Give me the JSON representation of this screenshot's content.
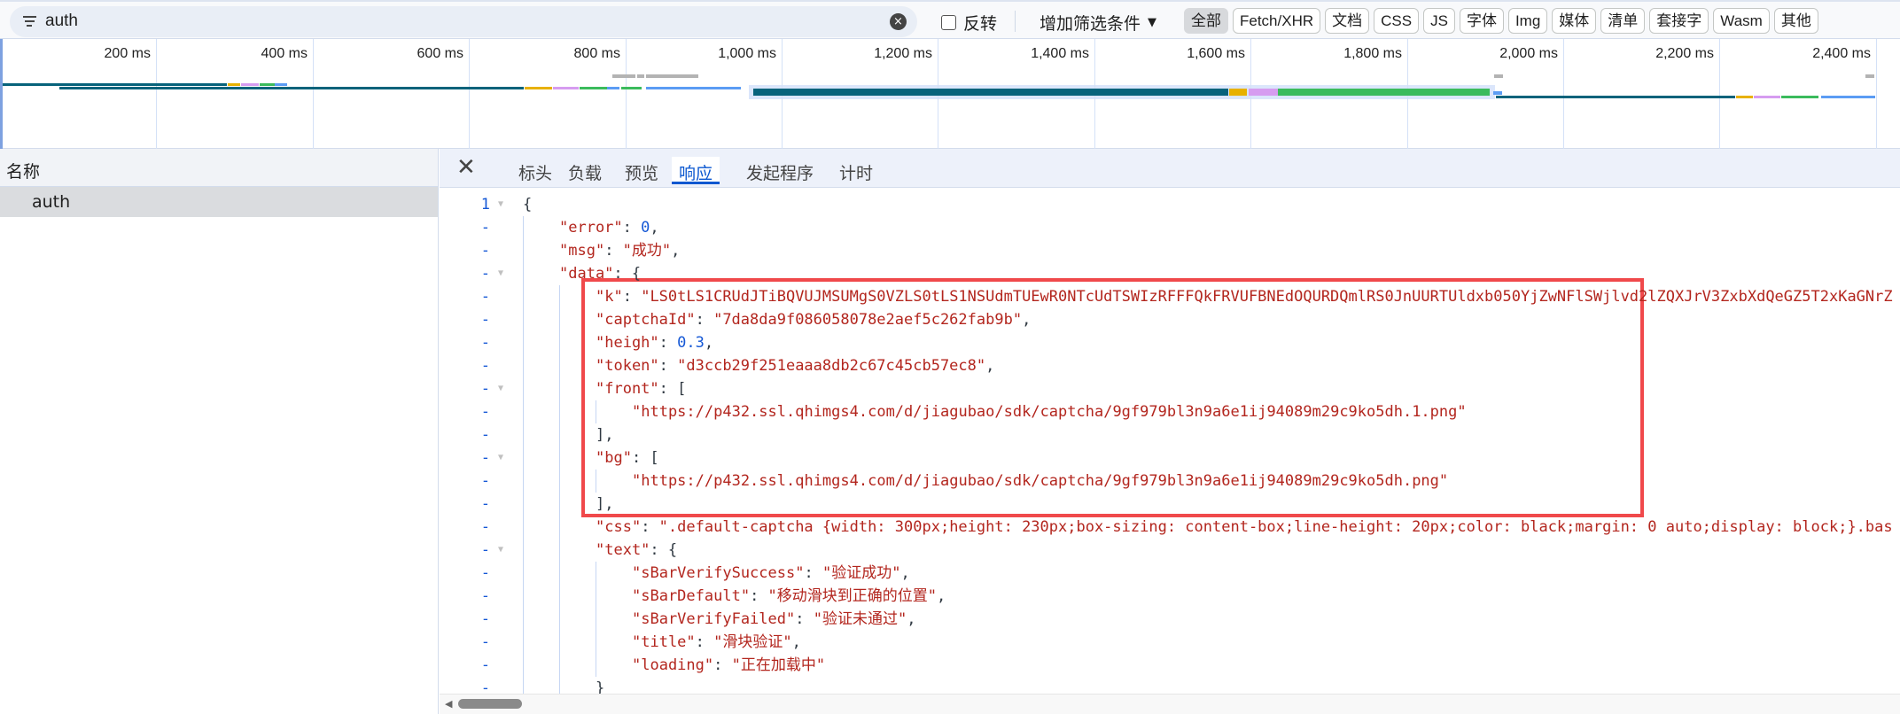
{
  "filter": {
    "value": "auth",
    "invert_label": "反转",
    "add_filter_label": "增加筛选条件",
    "types": [
      "全部",
      "Fetch/XHR",
      "文档",
      "CSS",
      "JS",
      "字体",
      "Img",
      "媒体",
      "清单",
      "套接字",
      "Wasm",
      "其他"
    ],
    "active_type": "全部"
  },
  "timeline": {
    "ticks": [
      "200 ms",
      "400 ms",
      "600 ms",
      "800 ms",
      "1,000 ms",
      "1,200 ms",
      "1,400 ms",
      "1,600 ms",
      "1,800 ms",
      "2,000 ms",
      "2,200 ms",
      "2,400 ms"
    ],
    "colors": {
      "waiting": "#07637b",
      "queue": "#e8b100",
      "purple": "#d69cf0",
      "green": "#3bbb5c",
      "blue": "#5b9cf4",
      "gray": "#b3b3b3"
    },
    "rows": [
      {
        "row": "gray",
        "segments": [
          [
            783,
            814,
            "gray"
          ],
          [
            815,
            825,
            "gray"
          ],
          [
            826,
            894,
            "gray"
          ],
          [
            1911,
            1923,
            "gray"
          ],
          [
            2387,
            2400,
            "gray"
          ]
        ]
      },
      {
        "row": "r1",
        "segments": [
          [
            3,
            291,
            "waiting"
          ],
          [
            291,
            308,
            "queue"
          ],
          [
            308,
            332,
            "purple"
          ],
          [
            332,
            352,
            "green"
          ],
          [
            352,
            369,
            "blue"
          ]
        ]
      },
      {
        "row": "r2",
        "segments": [
          [
            76,
            671,
            "waiting"
          ],
          [
            671,
            707,
            "queue"
          ],
          [
            707,
            741,
            "purple"
          ],
          [
            741,
            777,
            "green"
          ],
          [
            777,
            794,
            "blue"
          ],
          [
            795,
            822,
            "green"
          ],
          [
            826,
            949,
            "blue"
          ]
        ]
      },
      {
        "row": "selected",
        "segments": [
          [
            964,
            1573,
            "waiting"
          ],
          [
            1573,
            1597,
            "queue"
          ],
          [
            1597,
            1635,
            "purple"
          ],
          [
            1635,
            1907,
            "green"
          ],
          [
            1910,
            1922,
            "blue"
          ]
        ]
      },
      {
        "row": "r4",
        "segments": [
          [
            1914,
            2221,
            "waiting"
          ],
          [
            2221,
            2244,
            "queue"
          ],
          [
            2244,
            2279,
            "purple"
          ],
          [
            2279,
            2328,
            "green"
          ],
          [
            2330,
            2400,
            "blue"
          ]
        ]
      }
    ]
  },
  "requests": {
    "header": "名称",
    "items": [
      "auth"
    ]
  },
  "detail": {
    "tabs": [
      "标头",
      "负载",
      "预览",
      "响应",
      "发起程序",
      "计时"
    ],
    "active_tab": "响应",
    "lines": [
      {
        "num": "1",
        "ind": 0,
        "fold": true,
        "parts": [
          [
            "p",
            "{"
          ]
        ]
      },
      {
        "num": "-",
        "ind": 1,
        "parts": [
          [
            "k",
            "\"error\""
          ],
          [
            "p",
            ": "
          ],
          [
            "n",
            "0"
          ],
          [
            "p",
            ","
          ]
        ]
      },
      {
        "num": "-",
        "ind": 1,
        "parts": [
          [
            "k",
            "\"msg\""
          ],
          [
            "p",
            ": "
          ],
          [
            "s",
            "\"成功\""
          ],
          [
            "p",
            ","
          ]
        ]
      },
      {
        "num": "-",
        "ind": 1,
        "fold": true,
        "parts": [
          [
            "k",
            "\"data\""
          ],
          [
            "p",
            ": {"
          ]
        ]
      },
      {
        "num": "-",
        "ind": 2,
        "parts": [
          [
            "k",
            "\"k\""
          ],
          [
            "p",
            ": "
          ],
          [
            "s",
            "\"LS0tLS1CRUdJTiBQVUJMSUMgS0VZLS0tLS1NSUdmTUEwR0NTcUdTSWIzRFFFQkFRVUFBNEdOQURDQmlRS0JnUURTUldxb050YjZwNFlSWjlvd2lZQXJrV3ZxbXdQeGZ5T2xKaGNrZ"
          ]
        ]
      },
      {
        "num": "-",
        "ind": 2,
        "parts": [
          [
            "k",
            "\"captchaId\""
          ],
          [
            "p",
            ": "
          ],
          [
            "s",
            "\"7da8da9f086058078e2aef5c262fab9b\""
          ],
          [
            "p",
            ","
          ]
        ]
      },
      {
        "num": "-",
        "ind": 2,
        "parts": [
          [
            "k",
            "\"heigh\""
          ],
          [
            "p",
            ": "
          ],
          [
            "n",
            "0.3"
          ],
          [
            "p",
            ","
          ]
        ]
      },
      {
        "num": "-",
        "ind": 2,
        "parts": [
          [
            "k",
            "\"token\""
          ],
          [
            "p",
            ": "
          ],
          [
            "s",
            "\"d3ccb29f251eaaa8db2c67c45cb57ec8\""
          ],
          [
            "p",
            ","
          ]
        ]
      },
      {
        "num": "-",
        "ind": 2,
        "fold": true,
        "parts": [
          [
            "k",
            "\"front\""
          ],
          [
            "p",
            ": ["
          ]
        ]
      },
      {
        "num": "-",
        "ind": 3,
        "parts": [
          [
            "s",
            "\"https://p432.ssl.qhimgs4.com/d/jiagubao/sdk/captcha/9gf979bl3n9a6e1ij94089m29c9ko5dh.1.png\""
          ]
        ]
      },
      {
        "num": "-",
        "ind": 2,
        "parts": [
          [
            "p",
            "],"
          ]
        ]
      },
      {
        "num": "-",
        "ind": 2,
        "fold": true,
        "parts": [
          [
            "k",
            "\"bg\""
          ],
          [
            "p",
            ": ["
          ]
        ]
      },
      {
        "num": "-",
        "ind": 3,
        "parts": [
          [
            "s",
            "\"https://p432.ssl.qhimgs4.com/d/jiagubao/sdk/captcha/9gf979bl3n9a6e1ij94089m29c9ko5dh.png\""
          ]
        ]
      },
      {
        "num": "-",
        "ind": 2,
        "parts": [
          [
            "p",
            "],"
          ]
        ]
      },
      {
        "num": "-",
        "ind": 2,
        "parts": [
          [
            "k",
            "\"css\""
          ],
          [
            "p",
            ": "
          ],
          [
            "s",
            "\".default-captcha {width: 300px;height: 230px;box-sizing: content-box;line-height: 20px;color: black;margin: 0 auto;display: block;}.bas"
          ]
        ]
      },
      {
        "num": "-",
        "ind": 2,
        "fold": true,
        "parts": [
          [
            "k",
            "\"text\""
          ],
          [
            "p",
            ": {"
          ]
        ]
      },
      {
        "num": "-",
        "ind": 3,
        "parts": [
          [
            "k",
            "\"sBarVerifySuccess\""
          ],
          [
            "p",
            ": "
          ],
          [
            "s",
            "\"验证成功\""
          ],
          [
            "p",
            ","
          ]
        ]
      },
      {
        "num": "-",
        "ind": 3,
        "parts": [
          [
            "k",
            "\"sBarDefault\""
          ],
          [
            "p",
            ": "
          ],
          [
            "s",
            "\"移动滑块到正确的位置\""
          ],
          [
            "p",
            ","
          ]
        ]
      },
      {
        "num": "-",
        "ind": 3,
        "parts": [
          [
            "k",
            "\"sBarVerifyFailed\""
          ],
          [
            "p",
            ": "
          ],
          [
            "s",
            "\"验证未通过\""
          ],
          [
            "p",
            ","
          ]
        ]
      },
      {
        "num": "-",
        "ind": 3,
        "parts": [
          [
            "k",
            "\"title\""
          ],
          [
            "p",
            ": "
          ],
          [
            "s",
            "\"滑块验证\""
          ],
          [
            "p",
            ","
          ]
        ]
      },
      {
        "num": "-",
        "ind": 3,
        "parts": [
          [
            "k",
            "\"loading\""
          ],
          [
            "p",
            ": "
          ],
          [
            "s",
            "\"正在加载中\""
          ]
        ]
      },
      {
        "num": "-",
        "ind": 2,
        "parts": [
          [
            "p",
            "}"
          ]
        ]
      }
    ]
  }
}
